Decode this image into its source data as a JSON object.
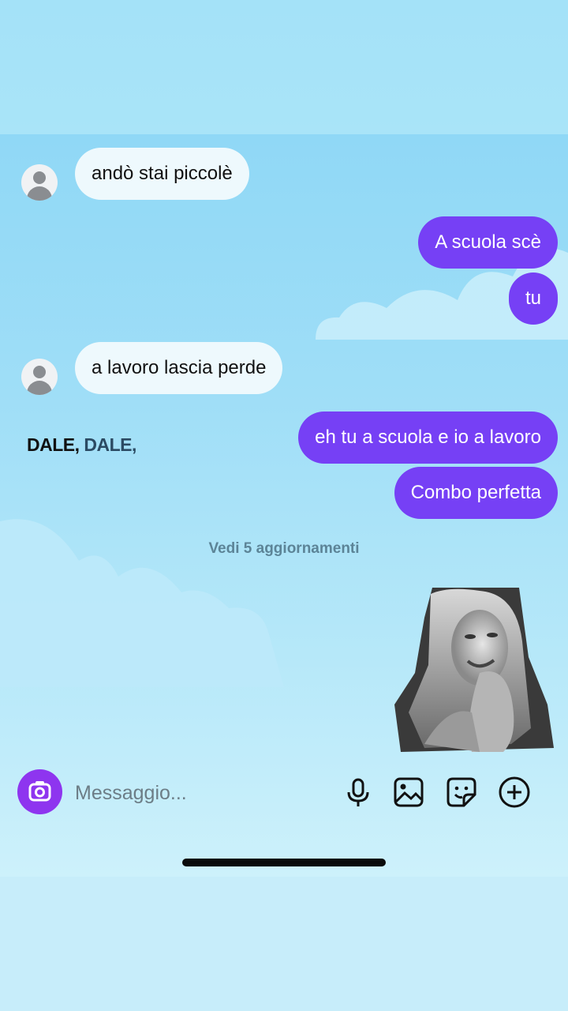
{
  "messages": [
    {
      "direction": "incoming",
      "text": "andò stai piccolè"
    },
    {
      "direction": "outgoing",
      "text": "A scuola scè"
    },
    {
      "direction": "outgoing",
      "text": "tu"
    },
    {
      "direction": "incoming",
      "text": "a lavoro lascia perde"
    },
    {
      "direction": "outgoing",
      "text": "eh tu a scuola e io a lavoro"
    },
    {
      "direction": "outgoing",
      "text": "Combo perfetta"
    }
  ],
  "reaction_text": {
    "first": "DALE,",
    "second": "DALE,"
  },
  "updates_link": "Vedi 5 aggiornamenti",
  "composer": {
    "placeholder": "Messaggio...",
    "icons": [
      "camera-icon",
      "microphone-icon",
      "gallery-icon",
      "sticker-icon",
      "add-icon"
    ]
  },
  "colors": {
    "outgoing_bubble": "#7640f5",
    "incoming_bubble": "#eef9fd",
    "camera_button": "#8e35ef",
    "chat_background": "#9fdef7"
  }
}
